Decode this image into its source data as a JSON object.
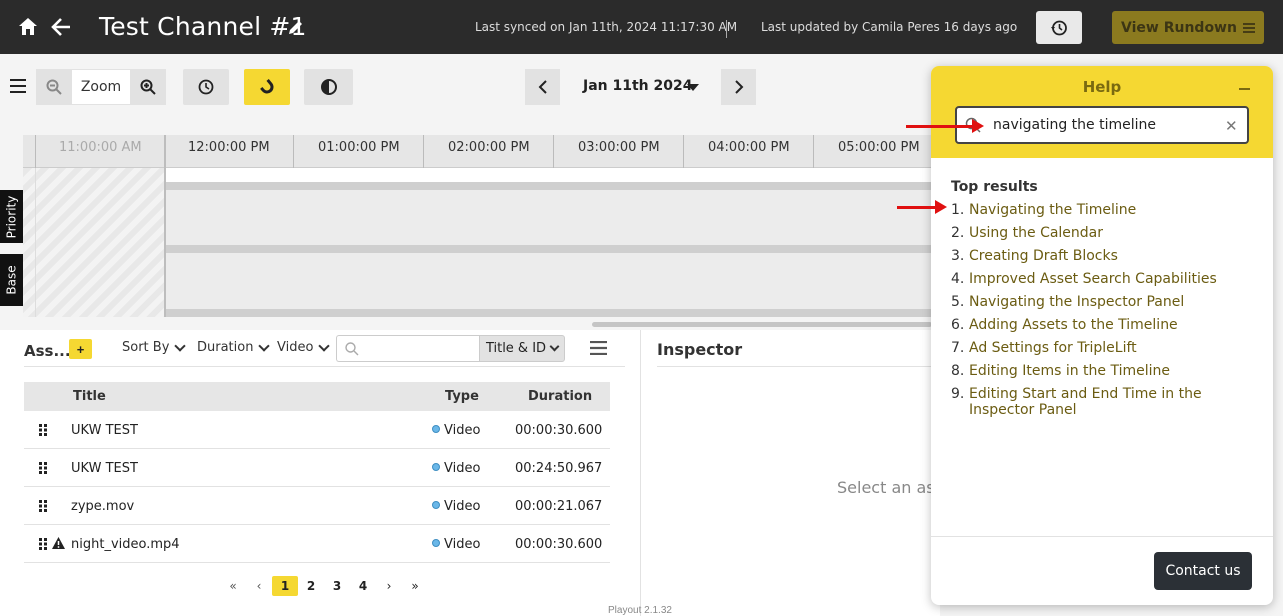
{
  "topbar": {
    "title": "Test Channel #1",
    "last_synced": "Last synced on Jan 11th, 2024 11:17:30 AM",
    "last_updated": "Last updated by Camila Peres 16 days ago",
    "view_rundown_label": "View Rundown"
  },
  "toolbar": {
    "zoom_label": "Zoom",
    "date_label": "Jan 11th 2024"
  },
  "timeline": {
    "times": [
      "11:00:00 AM",
      "12:00:00 PM",
      "01:00:00 PM",
      "02:00:00 PM",
      "03:00:00 PM",
      "04:00:00 PM",
      "05:00:00 PM"
    ],
    "rows": [
      "Priority",
      "Base"
    ]
  },
  "assets": {
    "heading": "Ass...",
    "add_label": "+",
    "sort_by": "Sort By",
    "duration_filter": "Duration",
    "video_filter": "Video",
    "search_placeholder": "",
    "search_field": "Title & ID",
    "columns": [
      "Title",
      "Type",
      "Duration"
    ],
    "rows": [
      {
        "title": "UKW TEST",
        "type": "Video",
        "duration": "00:00:30.600"
      },
      {
        "title": "UKW TEST",
        "type": "Video",
        "duration": "00:24:50.967"
      },
      {
        "title": "zype.mov",
        "type": "Video",
        "duration": "00:00:21.067"
      },
      {
        "title": "night_video.mp4",
        "type": "Video",
        "duration": "00:00:30.600"
      }
    ],
    "pages": [
      "1",
      "2",
      "3",
      "4"
    ]
  },
  "inspector": {
    "title": "Inspector",
    "empty_message": "Select an ass"
  },
  "version": "Playout 2.1.32",
  "help": {
    "title": "Help",
    "search_value": "navigating the timeline",
    "results_title": "Top results",
    "results": [
      "Navigating the Timeline",
      "Using the Calendar",
      "Creating Draft Blocks",
      "Improved Asset Search Capabilities",
      "Navigating the Inspector Panel",
      "Adding Assets to the Timeline",
      "Ad Settings for TripleLift",
      "Editing Items in the Timeline",
      "Editing Start and End Time in the Inspector Panel"
    ],
    "contact_label": "Contact us"
  },
  "colors": {
    "accent_yellow": "#f5d832",
    "topbar_bg": "#2b2b2b",
    "link": "#6b5c12",
    "annotation_red": "#e01010"
  }
}
